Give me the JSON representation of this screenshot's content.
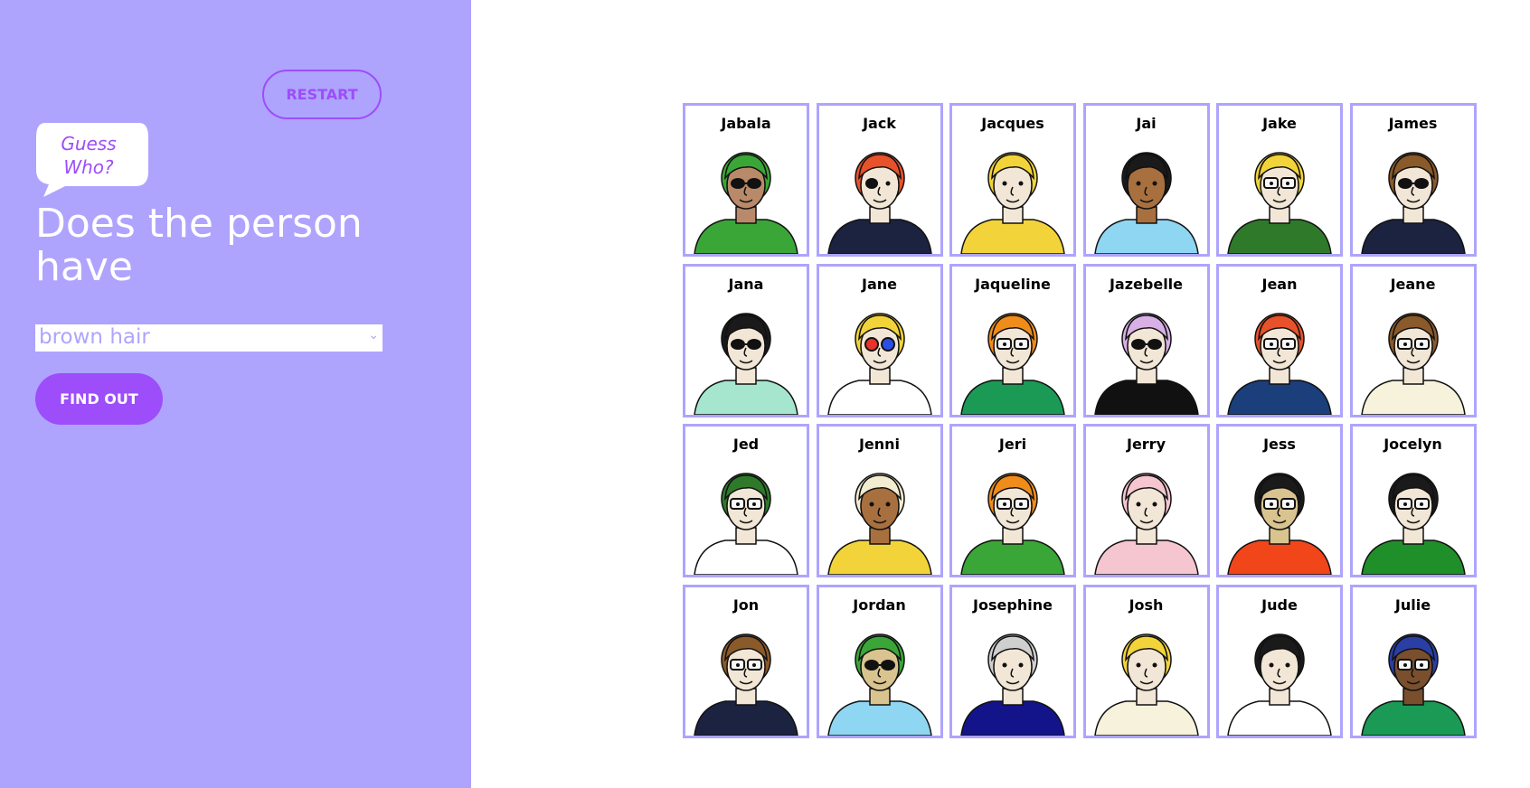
{
  "sidebar": {
    "restart_label": "RESTART",
    "logo_text_line1": "Guess",
    "logo_text_line2": "Who?",
    "question": "Does the person have",
    "select_value": "brown hair",
    "findout_label": "FIND OUT"
  },
  "colors": {
    "panel_bg": "#aea4fe",
    "accent": "#9d4dfa",
    "card_border": "#aea4fe"
  },
  "characters": [
    {
      "name": "Jabala",
      "hair": "#3aa637",
      "skin": "#b98a6a",
      "shirt": "#3aa637",
      "glasses": "sun"
    },
    {
      "name": "Jack",
      "hair": "#e8522a",
      "skin": "#f2e6d6",
      "shirt": "#1c2340",
      "glasses": "eyepatch"
    },
    {
      "name": "Jacques",
      "hair": "#f2d43a",
      "skin": "#f2e6d6",
      "shirt": "#f2d43a",
      "glasses": "none"
    },
    {
      "name": "Jai",
      "hair": "#1a1a1a",
      "skin": "#a8703f",
      "shirt": "#8fd6f2",
      "glasses": "none"
    },
    {
      "name": "Jake",
      "hair": "#f2d43a",
      "skin": "#f2e6d6",
      "shirt": "#2f7a2a",
      "glasses": "clear"
    },
    {
      "name": "James",
      "hair": "#8a5a2a",
      "skin": "#f2e6d6",
      "shirt": "#1c2340",
      "glasses": "sun"
    },
    {
      "name": "Jana",
      "hair": "#1a1a1a",
      "skin": "#f2e6d6",
      "shirt": "#a6e6cf",
      "glasses": "sun"
    },
    {
      "name": "Jane",
      "hair": "#f2d43a",
      "skin": "#f2e6d6",
      "shirt": "#ffffff",
      "glasses": "color"
    },
    {
      "name": "Jaqueline",
      "hair": "#f08c1a",
      "skin": "#f2e6d6",
      "shirt": "#1a9a55",
      "glasses": "clear"
    },
    {
      "name": "Jazebelle",
      "hair": "#d8b0e6",
      "skin": "#f2e6d6",
      "shirt": "#111111",
      "glasses": "sun"
    },
    {
      "name": "Jean",
      "hair": "#e8522a",
      "skin": "#f2e6d6",
      "shirt": "#1a3f7a",
      "glasses": "clear"
    },
    {
      "name": "Jeane",
      "hair": "#8a5a2a",
      "skin": "#f2e6d6",
      "shirt": "#f7f2dc",
      "glasses": "clear"
    },
    {
      "name": "Jed",
      "hair": "#2f7a2a",
      "skin": "#f2e6d6",
      "shirt": "#ffffff",
      "glasses": "clear"
    },
    {
      "name": "Jenni",
      "hair": "#f2ecd0",
      "skin": "#a8703f",
      "shirt": "#f2d43a",
      "glasses": "none"
    },
    {
      "name": "Jeri",
      "hair": "#f08c1a",
      "skin": "#f2e6d6",
      "shirt": "#3aa637",
      "glasses": "clear"
    },
    {
      "name": "Jerry",
      "hair": "#f6c6d0",
      "skin": "#f2e6d6",
      "shirt": "#f6c6d0",
      "glasses": "none"
    },
    {
      "name": "Jess",
      "hair": "#1a1a1a",
      "skin": "#d9c48f",
      "shirt": "#f0461a",
      "glasses": "clear"
    },
    {
      "name": "Jocelyn",
      "hair": "#1a1a1a",
      "skin": "#f2e6d6",
      "shirt": "#1f8f2a",
      "glasses": "clear"
    },
    {
      "name": "Jon",
      "hair": "#8a5a2a",
      "skin": "#f2e6d6",
      "shirt": "#1c2340",
      "glasses": "clear"
    },
    {
      "name": "Jordan",
      "hair": "#3aa637",
      "skin": "#d9c48f",
      "shirt": "#8fd6f2",
      "glasses": "sun"
    },
    {
      "name": "Josephine",
      "hair": "#cfcfcf",
      "skin": "#f2e6d6",
      "shirt": "#14148a",
      "glasses": "none"
    },
    {
      "name": "Josh",
      "hair": "#f2d43a",
      "skin": "#f2e6d6",
      "shirt": "#f7f2dc",
      "glasses": "none"
    },
    {
      "name": "Jude",
      "hair": "#1a1a1a",
      "skin": "#f2e6d6",
      "shirt": "#ffffff",
      "glasses": "none"
    },
    {
      "name": "Julie",
      "hair": "#2a3fa6",
      "skin": "#7a4f2e",
      "shirt": "#1a9a55",
      "glasses": "clear"
    }
  ]
}
